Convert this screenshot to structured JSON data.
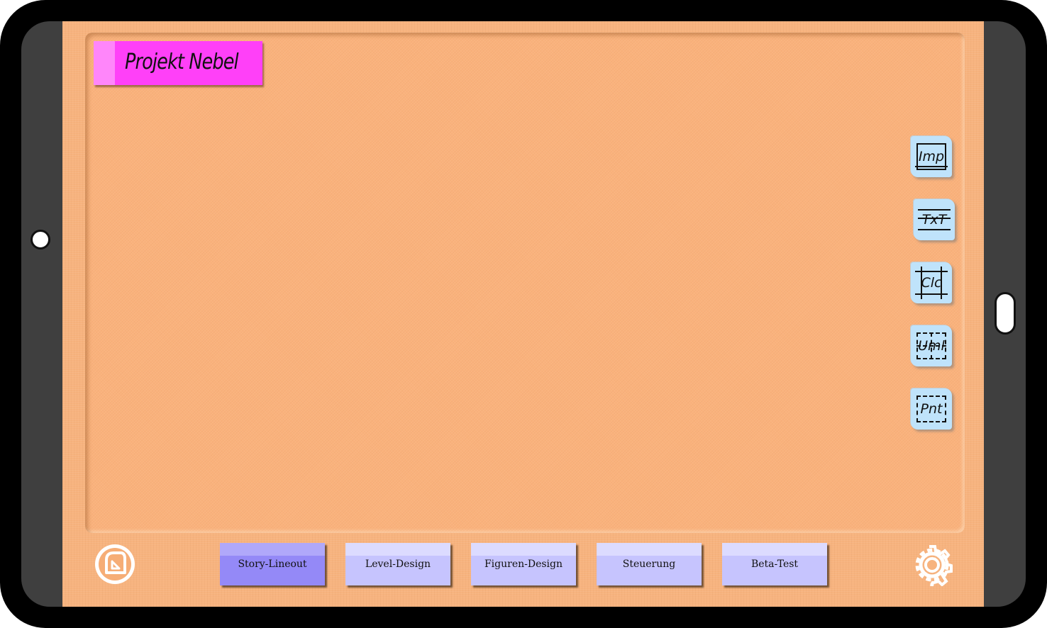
{
  "project": {
    "title": "Projekt Nebel"
  },
  "tools": [
    {
      "label": "Imp",
      "icon": "image-frame-icon"
    },
    {
      "label": "TxT",
      "icon": "text-lines-icon"
    },
    {
      "label": "Clc",
      "icon": "grid-icon"
    },
    {
      "label": "Uml",
      "icon": "dashed-grid-icon"
    },
    {
      "label": "Pnt",
      "icon": "dashed-frame-icon"
    }
  ],
  "tabs": [
    {
      "label": "Story-Lineout",
      "active": true
    },
    {
      "label": "Level-Design",
      "active": false
    },
    {
      "label": "Figuren-Design",
      "active": false
    },
    {
      "label": "Steuerung",
      "active": false
    },
    {
      "label": "Beta-Test",
      "active": false
    }
  ],
  "colors": {
    "board": "#fab27c",
    "title_note": "#ff40f8",
    "tool_note": "#bfe3fb",
    "tab": "#c6c4fe",
    "tab_active": "#9489f7"
  }
}
